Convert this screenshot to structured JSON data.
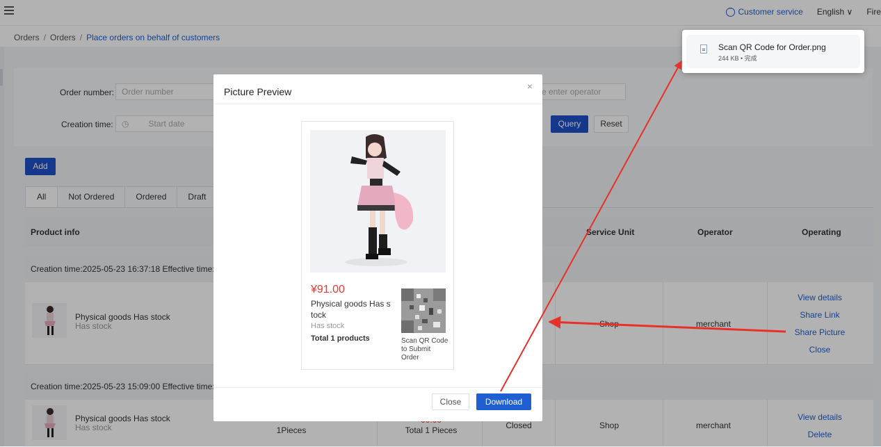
{
  "topbar": {
    "customer_service": "Customer service",
    "language": "English",
    "user": "Fire"
  },
  "breadcrumb": [
    "Orders",
    "Orders",
    "Place orders on behalf of customers"
  ],
  "filters": {
    "order_number_label": "Order number:",
    "order_number_placeholder": "Order number",
    "operator_placeholder": "e enter operator",
    "creation_time_label": "Creation time:",
    "start_date_placeholder": "Start date",
    "query_label": "Query",
    "reset_label": "Reset"
  },
  "add_label": "Add",
  "tabs": [
    "All",
    "Not Ordered",
    "Ordered",
    "Draft"
  ],
  "table_headers": {
    "product_info": "Product info",
    "service_unit": "Service Unit",
    "operator": "Operator",
    "operating": "Operating"
  },
  "orders": [
    {
      "group_header": "Creation time:2025-05-23 16:37:18   Effective time:20",
      "product_name": "Physical goods Has stock",
      "stock": "Has stock",
      "service_unit": "Shop",
      "operator": "merchant",
      "actions": [
        "View details",
        "Share Link",
        "Share Picture",
        "Close"
      ]
    },
    {
      "group_header": "Creation time:2025-05-23 15:09:00   Effective time:20",
      "product_name": "Physical goods Has stock",
      "stock": "Has stock",
      "quantity": "1Pieces",
      "price_partial": "00.00",
      "total": "Total 1 Pieces",
      "status": "Closed",
      "service_unit": "Shop",
      "operator": "merchant",
      "actions": [
        "View details",
        "Delete"
      ]
    }
  ],
  "modal": {
    "title": "Picture Preview",
    "close_x": "×",
    "price": "¥91.00",
    "product_name": "Physical goods Has s tock",
    "stock": "Has stock",
    "total": "Total 1 products",
    "qr_caption": "Scan QR Code to Submit Order",
    "close_button": "Close",
    "download_button": "Download"
  },
  "download_popup": {
    "file_name": "Scan QR Code for Order.png",
    "meta": "244 KB • 完成"
  },
  "colors": {
    "primary": "#1f5fd1",
    "price_red": "#e53935",
    "annotation_arrow": "#e8302a"
  }
}
